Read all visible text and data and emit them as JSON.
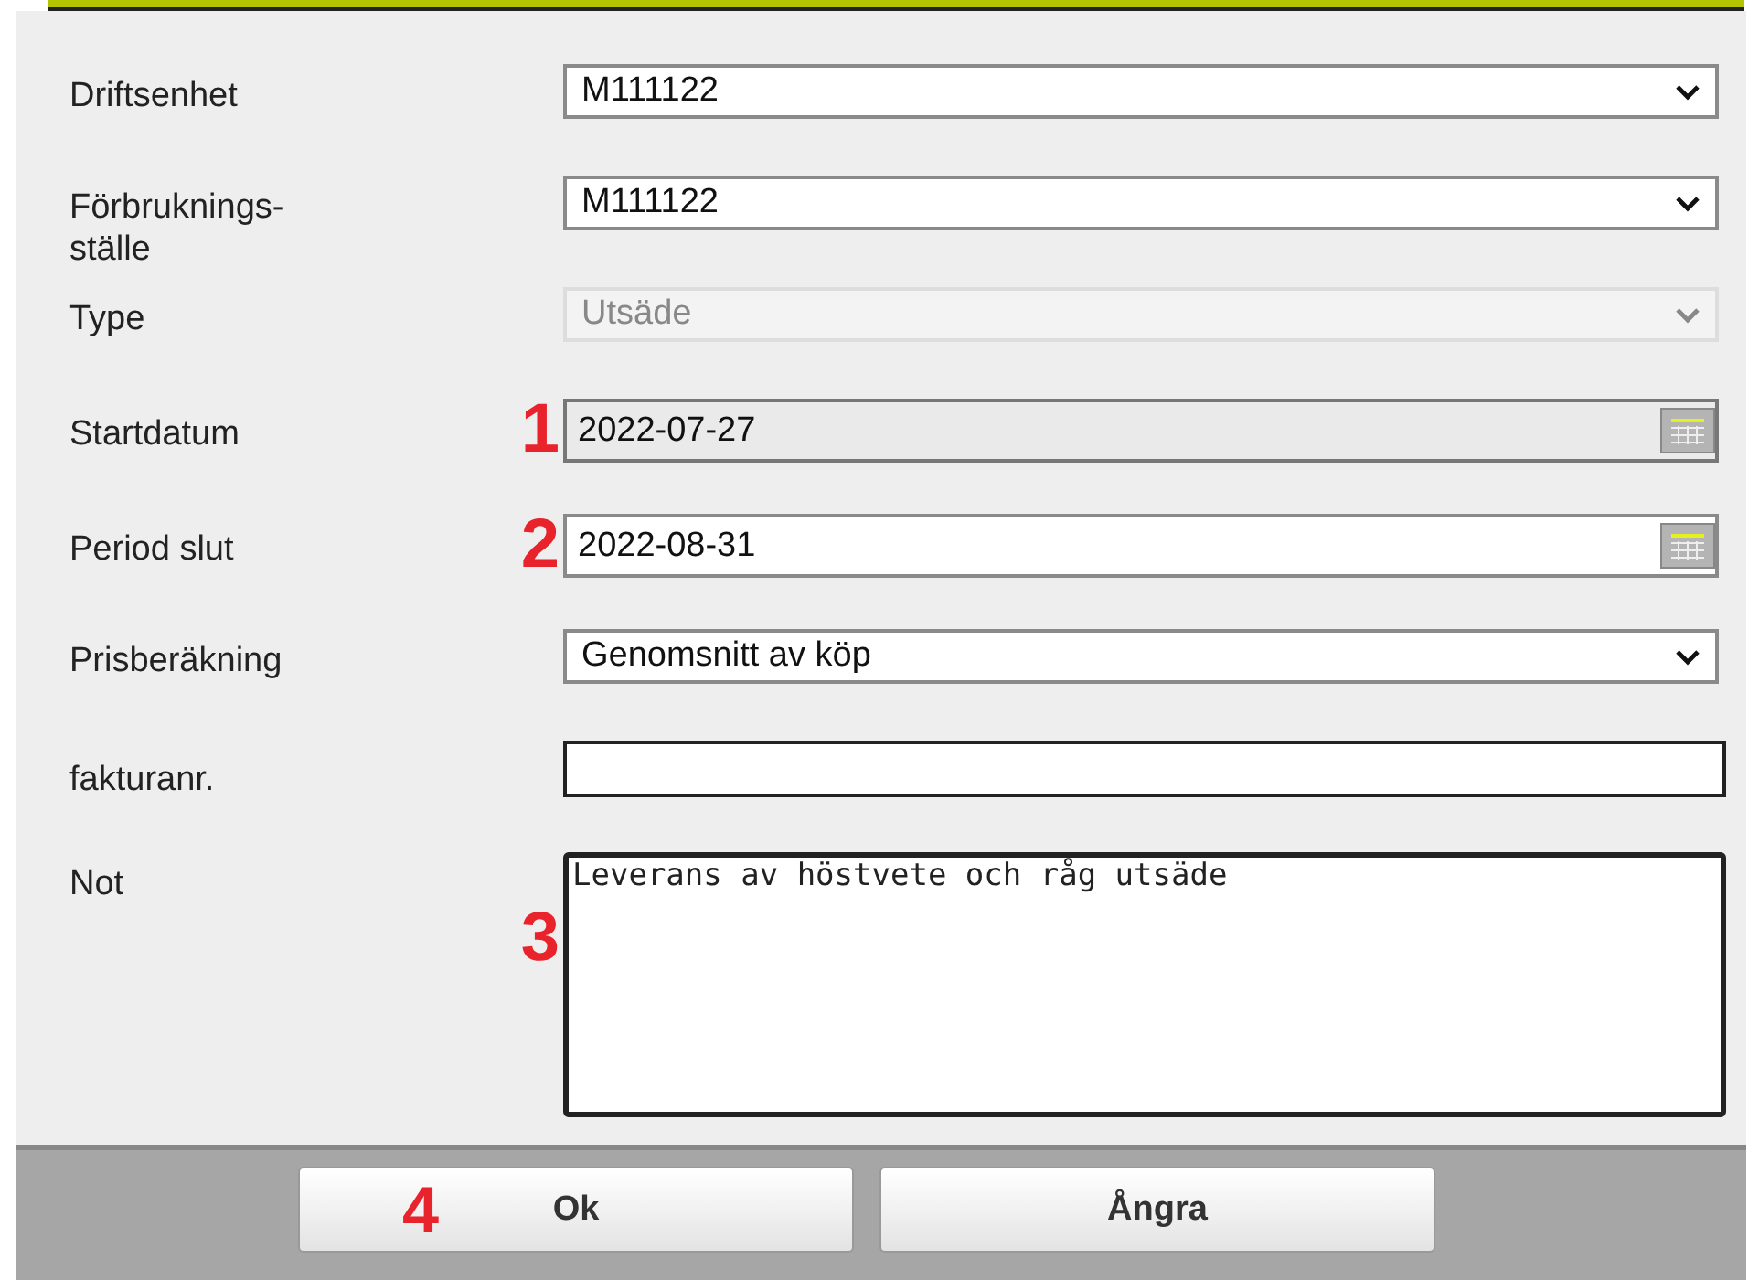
{
  "form": {
    "rows": [
      {
        "label": "Driftsenhet",
        "kind": "select",
        "value": "M111122",
        "disabled": false
      },
      {
        "label": "Förbruknings-ställe",
        "kind": "select",
        "value": "M111122",
        "disabled": false
      },
      {
        "label": "Type",
        "kind": "select",
        "value": "Utsäde",
        "disabled": true
      },
      {
        "label": "Startdatum",
        "kind": "date",
        "value": "2022-07-27",
        "disabled": true,
        "marker": "1"
      },
      {
        "label": "Period slut",
        "kind": "date",
        "value": "2022-08-31",
        "disabled": false,
        "marker": "2"
      },
      {
        "label": "Prisberäkning",
        "kind": "select",
        "value": "Genomsnitt av köp",
        "disabled": false
      },
      {
        "label": "fakturanr.",
        "kind": "text"
      },
      {
        "label": "Not",
        "kind": "textarea",
        "value": "Leverans av höstvete och råg utsäde",
        "marker": "3"
      }
    ]
  },
  "buttons": [
    {
      "label": "Ok",
      "marker": "4"
    },
    {
      "label": "Ångra"
    }
  ]
}
